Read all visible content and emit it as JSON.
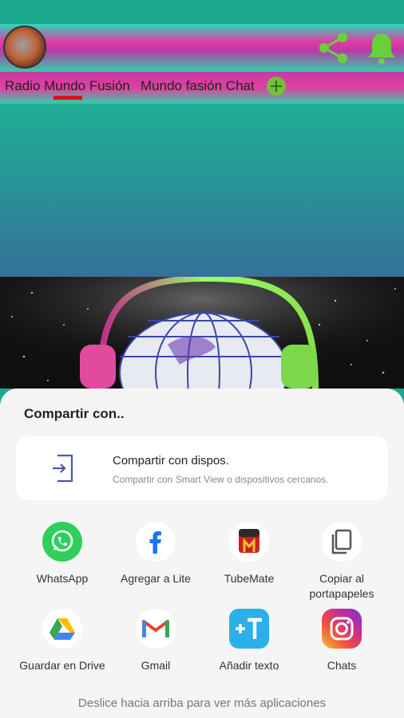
{
  "appbar": {
    "share_icon": "share-icon",
    "bell_icon": "bell-icon",
    "accent": "#6ad03a"
  },
  "tabs": [
    {
      "label": "Radio Mundo Fusión"
    },
    {
      "label": "Mundo fasión Chat"
    }
  ],
  "share_sheet": {
    "title": "Compartir con..",
    "nearby": {
      "title": "Compartir con dispos.",
      "subtitle": "Compartir con Smart View o dispositivos cercanos."
    },
    "apps": [
      {
        "label": "WhatsApp",
        "icon": "whatsapp-icon"
      },
      {
        "label": "Agregar a Lite",
        "icon": "facebook-lite-icon"
      },
      {
        "label": "TubeMate",
        "icon": "tubemate-icon"
      },
      {
        "label": "Copiar al portapapeles",
        "icon": "copy-icon"
      },
      {
        "label": "Guardar en Drive",
        "icon": "drive-icon"
      },
      {
        "label": "Gmail",
        "icon": "gmail-icon"
      },
      {
        "label": "Añadir texto",
        "icon": "add-text-icon"
      },
      {
        "label": "Chats",
        "icon": "instagram-icon"
      }
    ],
    "hint": "Deslice hacia arriba para ver más aplicaciones"
  }
}
